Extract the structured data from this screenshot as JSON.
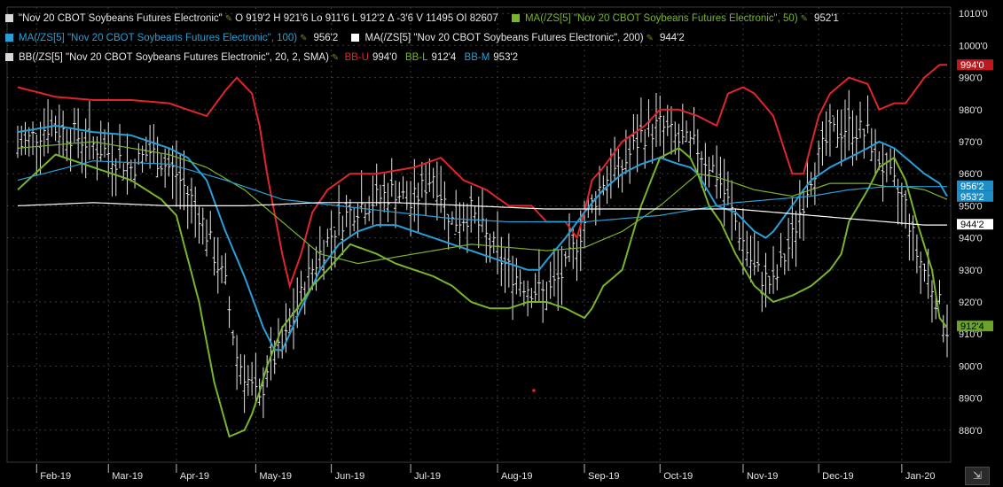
{
  "header_stub": "",
  "legend": {
    "row1": {
      "main": {
        "label": "\"Nov 20 CBOT Soybeans Futures Electronic\"",
        "color": "#d8d8d8",
        "ohlc": "O 919'2  H 921'6  Lo 911'6  L 912'2  Δ -3'6  V 11495  OI 82607"
      },
      "ma50": {
        "label": "MA(/ZS[5] \"Nov 20 CBOT Soybeans Futures Electronic\", 50)",
        "value": "952'1",
        "color": "#7ab32e"
      }
    },
    "row2": {
      "ma100": {
        "label": "MA(/ZS[5] \"Nov 20 CBOT Soybeans Futures Electronic\", 100)",
        "value": "956'2",
        "color": "#2a9fd6"
      },
      "ma200": {
        "label": "MA(/ZS[5] \"Nov 20 CBOT Soybeans Futures Electronic\", 200)",
        "value": "944'2",
        "color": "#ffffff"
      }
    },
    "row3": {
      "bb": {
        "label": "BB(/ZS[5] \"Nov 20 CBOT Soybeans Futures Electronic\", 20, 2, SMA)",
        "color": "#d8d8d8"
      },
      "bbu": {
        "label": "BB-U",
        "value": "994'0",
        "color": "#e0262b"
      },
      "bbl": {
        "label": "BB-L",
        "value": "912'4",
        "color": "#7ab32e"
      },
      "bbm": {
        "label": "BB-M",
        "value": "953'2",
        "color": "#2a9fd6"
      }
    }
  },
  "price_tags": [
    {
      "text": "994'0",
      "price": 994.0,
      "bg": "#c0171c",
      "fg": "#ffffff"
    },
    {
      "text": "956'2",
      "price": 956.25,
      "bg": "#1e8ec9",
      "fg": "#ffffff"
    },
    {
      "text": "953'2",
      "price": 953.25,
      "bg": "#1e8ec9",
      "fg": "#ffffff"
    },
    {
      "text": "944'2",
      "price": 944.25,
      "bg": "#ffffff",
      "fg": "#000000"
    },
    {
      "text": "912'4",
      "price": 912.5,
      "bg": "#6aa32a",
      "fg": "#000000"
    }
  ],
  "corner_button": "⇲",
  "chart_data": {
    "type": "line",
    "title": "\"Nov 20 CBOT Soybeans Futures Electronic\"",
    "xlabel": "",
    "ylabel": "",
    "ylim": [
      870,
      1012
    ],
    "y_ticks": [
      "880'0",
      "890'0",
      "900'0",
      "910'0",
      "920'0",
      "930'0",
      "940'0",
      "950'0",
      "960'0",
      "970'0",
      "980'0",
      "990'0",
      "1000'0",
      "1010'0"
    ],
    "y_tick_values": [
      880,
      890,
      900,
      910,
      920,
      930,
      940,
      950,
      960,
      970,
      980,
      990,
      1000,
      1010
    ],
    "x_ticks": [
      "Feb-19",
      "Mar-19",
      "Apr-19",
      "May-19",
      "Jun-19",
      "Jul-19",
      "Aug-19",
      "Sep-19",
      "Oct-19",
      "Nov-19",
      "Dec-19",
      "Jan-20"
    ],
    "x_tick_index": [
      5,
      24,
      42,
      63,
      83,
      104,
      127,
      150,
      170,
      192,
      212,
      234
    ],
    "n_bars": 247,
    "grid": true,
    "price_bars": {
      "anchors_index": [
        0,
        8,
        15,
        25,
        30,
        35,
        42,
        48,
        55,
        58,
        62,
        64,
        66,
        70,
        73,
        77,
        80,
        85,
        90,
        95,
        100,
        104,
        110,
        115,
        120,
        125,
        130,
        135,
        140,
        145,
        150,
        155,
        160,
        165,
        170,
        175,
        180,
        185,
        190,
        195,
        200,
        205,
        210,
        215,
        220,
        225,
        230,
        235,
        238,
        242,
        246
      ],
      "anchors_close": [
        968,
        975,
        972,
        966,
        962,
        967,
        960,
        948,
        925,
        903,
        893,
        888,
        900,
        905,
        915,
        928,
        935,
        945,
        950,
        952,
        955,
        950,
        960,
        945,
        948,
        938,
        930,
        925,
        922,
        930,
        945,
        958,
        962,
        972,
        975,
        970,
        968,
        960,
        945,
        930,
        925,
        940,
        960,
        972,
        975,
        972,
        960,
        950,
        935,
        925,
        912
      ]
    },
    "series": [
      {
        "name": "BB-U",
        "color": "#e0262b",
        "x": [
          0,
          10,
          20,
          30,
          40,
          50,
          55,
          58,
          62,
          64,
          66,
          70,
          72,
          75,
          78,
          82,
          88,
          95,
          105,
          112,
          118,
          124,
          130,
          136,
          140,
          145,
          148,
          150,
          152,
          155,
          160,
          166,
          170,
          175,
          180,
          185,
          188,
          192,
          195,
          200,
          205,
          208,
          212,
          215,
          220,
          225,
          228,
          232,
          235,
          240,
          244,
          246
        ],
        "y": [
          987,
          984,
          983,
          983,
          982,
          978,
          986,
          990,
          985,
          975,
          960,
          935,
          925,
          935,
          948,
          955,
          960,
          960,
          962,
          965,
          958,
          955,
          950,
          950,
          945,
          945,
          940,
          948,
          958,
          962,
          970,
          975,
          980,
          980,
          978,
          975,
          985,
          987,
          985,
          978,
          960,
          960,
          978,
          985,
          990,
          988,
          980,
          982,
          982,
          990,
          994,
          994
        ]
      },
      {
        "name": "BB-M",
        "color": "#2a9fd6",
        "x": [
          0,
          10,
          20,
          30,
          40,
          45,
          50,
          55,
          60,
          65,
          68,
          70,
          72,
          75,
          78,
          80,
          85,
          90,
          95,
          100,
          105,
          110,
          115,
          120,
          125,
          130,
          135,
          138,
          140,
          145,
          150,
          155,
          160,
          165,
          170,
          175,
          178,
          180,
          183,
          185,
          190,
          195,
          198,
          200,
          205,
          208,
          210,
          215,
          220,
          225,
          228,
          232,
          235,
          240,
          244,
          246
        ],
        "y": [
          973,
          975,
          973,
          972,
          968,
          965,
          958,
          942,
          928,
          912,
          905,
          905,
          910,
          918,
          925,
          930,
          938,
          942,
          944,
          944,
          942,
          940,
          938,
          936,
          934,
          932,
          930,
          930,
          933,
          940,
          948,
          955,
          960,
          963,
          965,
          963,
          962,
          960,
          954,
          950,
          948,
          942,
          940,
          942,
          950,
          955,
          958,
          962,
          965,
          968,
          970,
          968,
          965,
          960,
          957,
          953
        ]
      },
      {
        "name": "BB-L",
        "color": "#7ab32e",
        "x": [
          0,
          10,
          20,
          30,
          38,
          42,
          48,
          52,
          56,
          60,
          62,
          64,
          66,
          70,
          74,
          78,
          82,
          88,
          95,
          100,
          105,
          110,
          115,
          120,
          125,
          130,
          135,
          140,
          145,
          150,
          152,
          155,
          160,
          165,
          170,
          175,
          178,
          180,
          183,
          186,
          190,
          195,
          200,
          205,
          210,
          215,
          218,
          220,
          225,
          228,
          232,
          235,
          238,
          242,
          244,
          246
        ],
        "y": [
          955,
          966,
          962,
          958,
          952,
          947,
          920,
          895,
          878,
          880,
          885,
          892,
          900,
          912,
          918,
          925,
          930,
          938,
          935,
          932,
          930,
          928,
          925,
          920,
          918,
          918,
          920,
          920,
          918,
          915,
          918,
          925,
          930,
          950,
          965,
          968,
          965,
          960,
          950,
          945,
          935,
          925,
          920,
          922,
          925,
          930,
          935,
          945,
          955,
          962,
          965,
          958,
          945,
          930,
          915,
          912
        ]
      },
      {
        "name": "MA 50",
        "color": "#7ab32e",
        "x": [
          0,
          20,
          40,
          50,
          60,
          70,
          80,
          90,
          100,
          110,
          120,
          130,
          140,
          150,
          160,
          170,
          175,
          180,
          185,
          190,
          195,
          200,
          205,
          210,
          215,
          220,
          225,
          230,
          235,
          240,
          246
        ],
        "y": [
          968,
          970,
          966,
          962,
          955,
          945,
          935,
          932,
          934,
          936,
          938,
          937,
          936,
          937,
          942,
          950,
          955,
          960,
          959,
          957,
          955,
          954,
          953,
          955,
          957,
          957,
          957,
          956,
          956,
          955,
          952
        ]
      },
      {
        "name": "MA 100",
        "color": "#2a9fd6",
        "x": [
          0,
          20,
          40,
          55,
          70,
          85,
          100,
          115,
          130,
          150,
          170,
          180,
          190,
          200,
          210,
          220,
          230,
          240,
          246
        ],
        "y": [
          958,
          964,
          963,
          958,
          952,
          950,
          948,
          946,
          945,
          945,
          947,
          949,
          951,
          952,
          953,
          955,
          956,
          956,
          956
        ]
      },
      {
        "name": "MA 200",
        "color": "#ffffff",
        "x": [
          0,
          20,
          40,
          60,
          80,
          100,
          120,
          140,
          160,
          180,
          190,
          200,
          210,
          220,
          230,
          240,
          246
        ],
        "y": [
          950,
          951,
          950,
          950,
          951,
          951,
          950,
          949,
          949,
          949,
          949,
          948,
          947,
          946,
          945,
          944,
          944
        ]
      }
    ]
  }
}
